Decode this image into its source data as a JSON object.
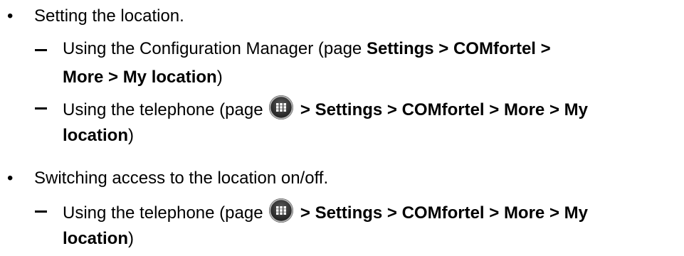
{
  "items": [
    {
      "text": "Setting the location.",
      "subitems": [
        {
          "line1_prefix": "Using the Configuration Manager (page ",
          "line1_bold": "Settings > COMfortel >",
          "line2_bold": "More > My location",
          "line2_suffix": ")"
        },
        {
          "line1_prefix": "Using the telephone (page ",
          "icon": "app-drawer-icon",
          "line1_bold": " > Settings > COMfortel > More > My",
          "line2_bold": "location",
          "line2_suffix": ")"
        }
      ]
    },
    {
      "text": "Switching access to the location on/off.",
      "subitems": [
        {
          "line1_prefix": "Using the telephone (page ",
          "icon": "app-drawer-icon",
          "line1_bold": " > Settings > COMfortel > More > My",
          "line2_bold": "location",
          "line2_suffix": ")"
        }
      ]
    }
  ]
}
